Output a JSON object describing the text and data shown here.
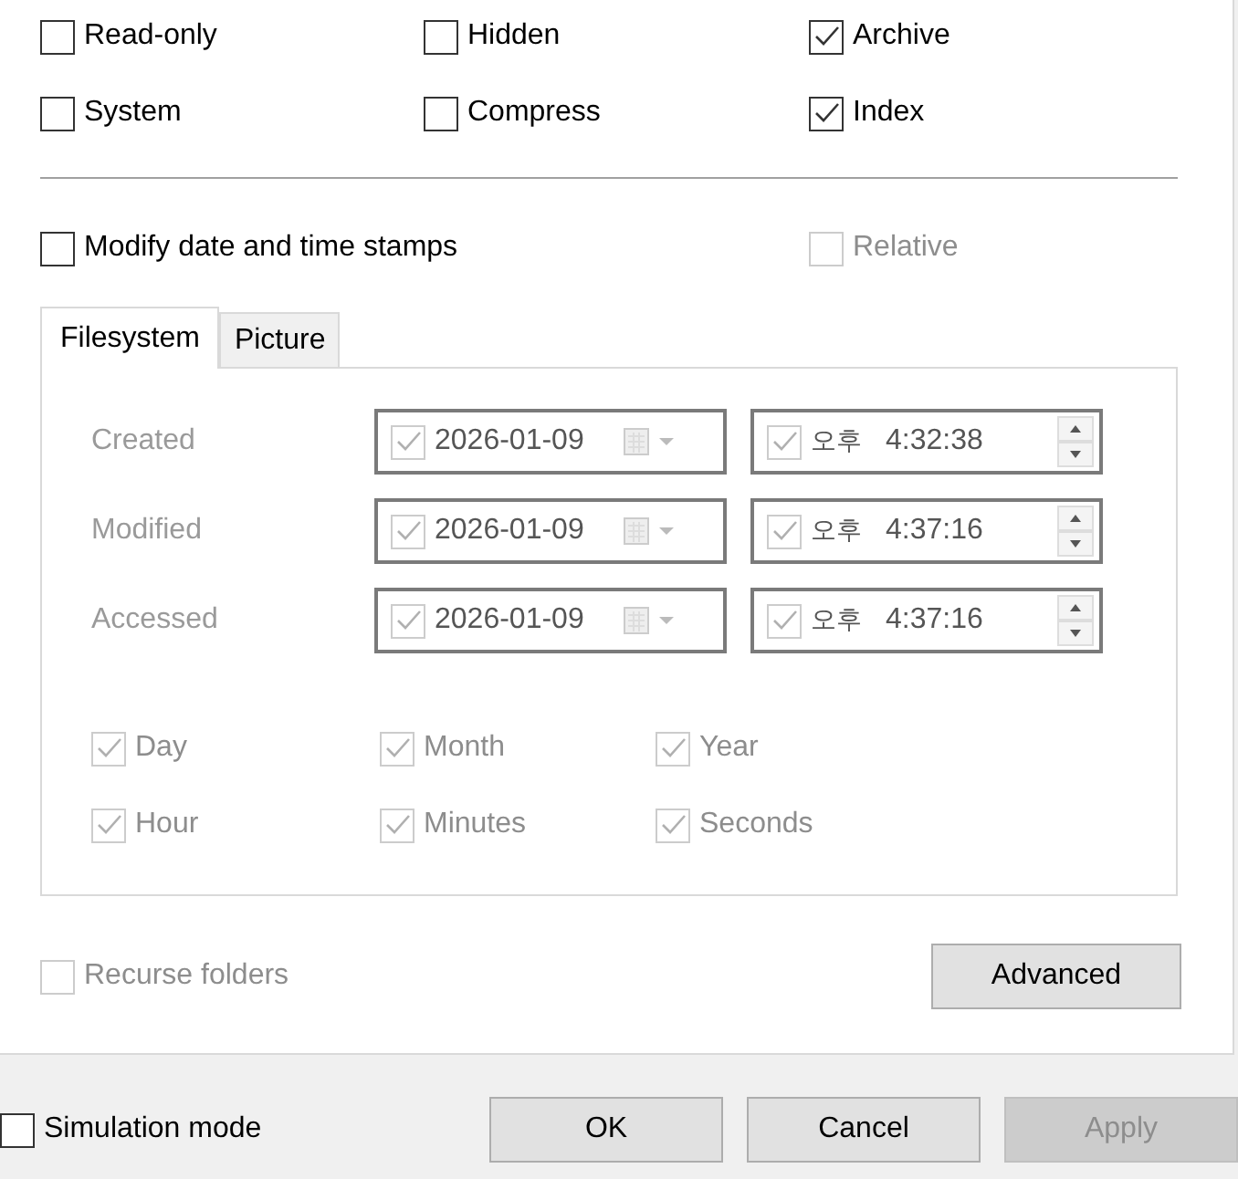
{
  "attributes": [
    {
      "label": "Read-only",
      "checked": false
    },
    {
      "label": "Hidden",
      "checked": false
    },
    {
      "label": "Archive",
      "checked": true
    },
    {
      "label": "System",
      "checked": false
    },
    {
      "label": "Compress",
      "checked": false
    },
    {
      "label": "Index",
      "checked": true
    }
  ],
  "modify_timestamps": {
    "label": "Modify date and time stamps",
    "checked": false
  },
  "relative": {
    "label": "Relative",
    "checked": false,
    "disabled": true
  },
  "tabs": [
    {
      "label": "Filesystem",
      "selected": true
    },
    {
      "label": "Picture",
      "selected": false
    }
  ],
  "timestamps": [
    {
      "label": "Created",
      "date": "2026-01-09",
      "date_checked": true,
      "ampm": "오후",
      "time": "4:32:38",
      "time_checked": true
    },
    {
      "label": "Modified",
      "date": "2026-01-09",
      "date_checked": true,
      "ampm": "오후",
      "time": "4:37:16",
      "time_checked": true
    },
    {
      "label": "Accessed",
      "date": "2026-01-09",
      "date_checked": true,
      "ampm": "오후",
      "time": "4:37:16",
      "time_checked": true
    }
  ],
  "parts": [
    {
      "label": "Day",
      "checked": true
    },
    {
      "label": "Month",
      "checked": true
    },
    {
      "label": "Year",
      "checked": true
    },
    {
      "label": "Hour",
      "checked": true
    },
    {
      "label": "Minutes",
      "checked": true
    },
    {
      "label": "Seconds",
      "checked": true
    }
  ],
  "timestamps_disabled": true,
  "recurse_folders": {
    "label": "Recurse folders",
    "checked": false,
    "disabled": true
  },
  "advanced_button": {
    "label": "Advanced"
  },
  "simulation_mode": {
    "label": "Simulation mode",
    "checked": false
  },
  "buttons": [
    {
      "label": "OK",
      "disabled": false
    },
    {
      "label": "Cancel",
      "disabled": false
    },
    {
      "label": "Apply",
      "disabled": true
    }
  ]
}
